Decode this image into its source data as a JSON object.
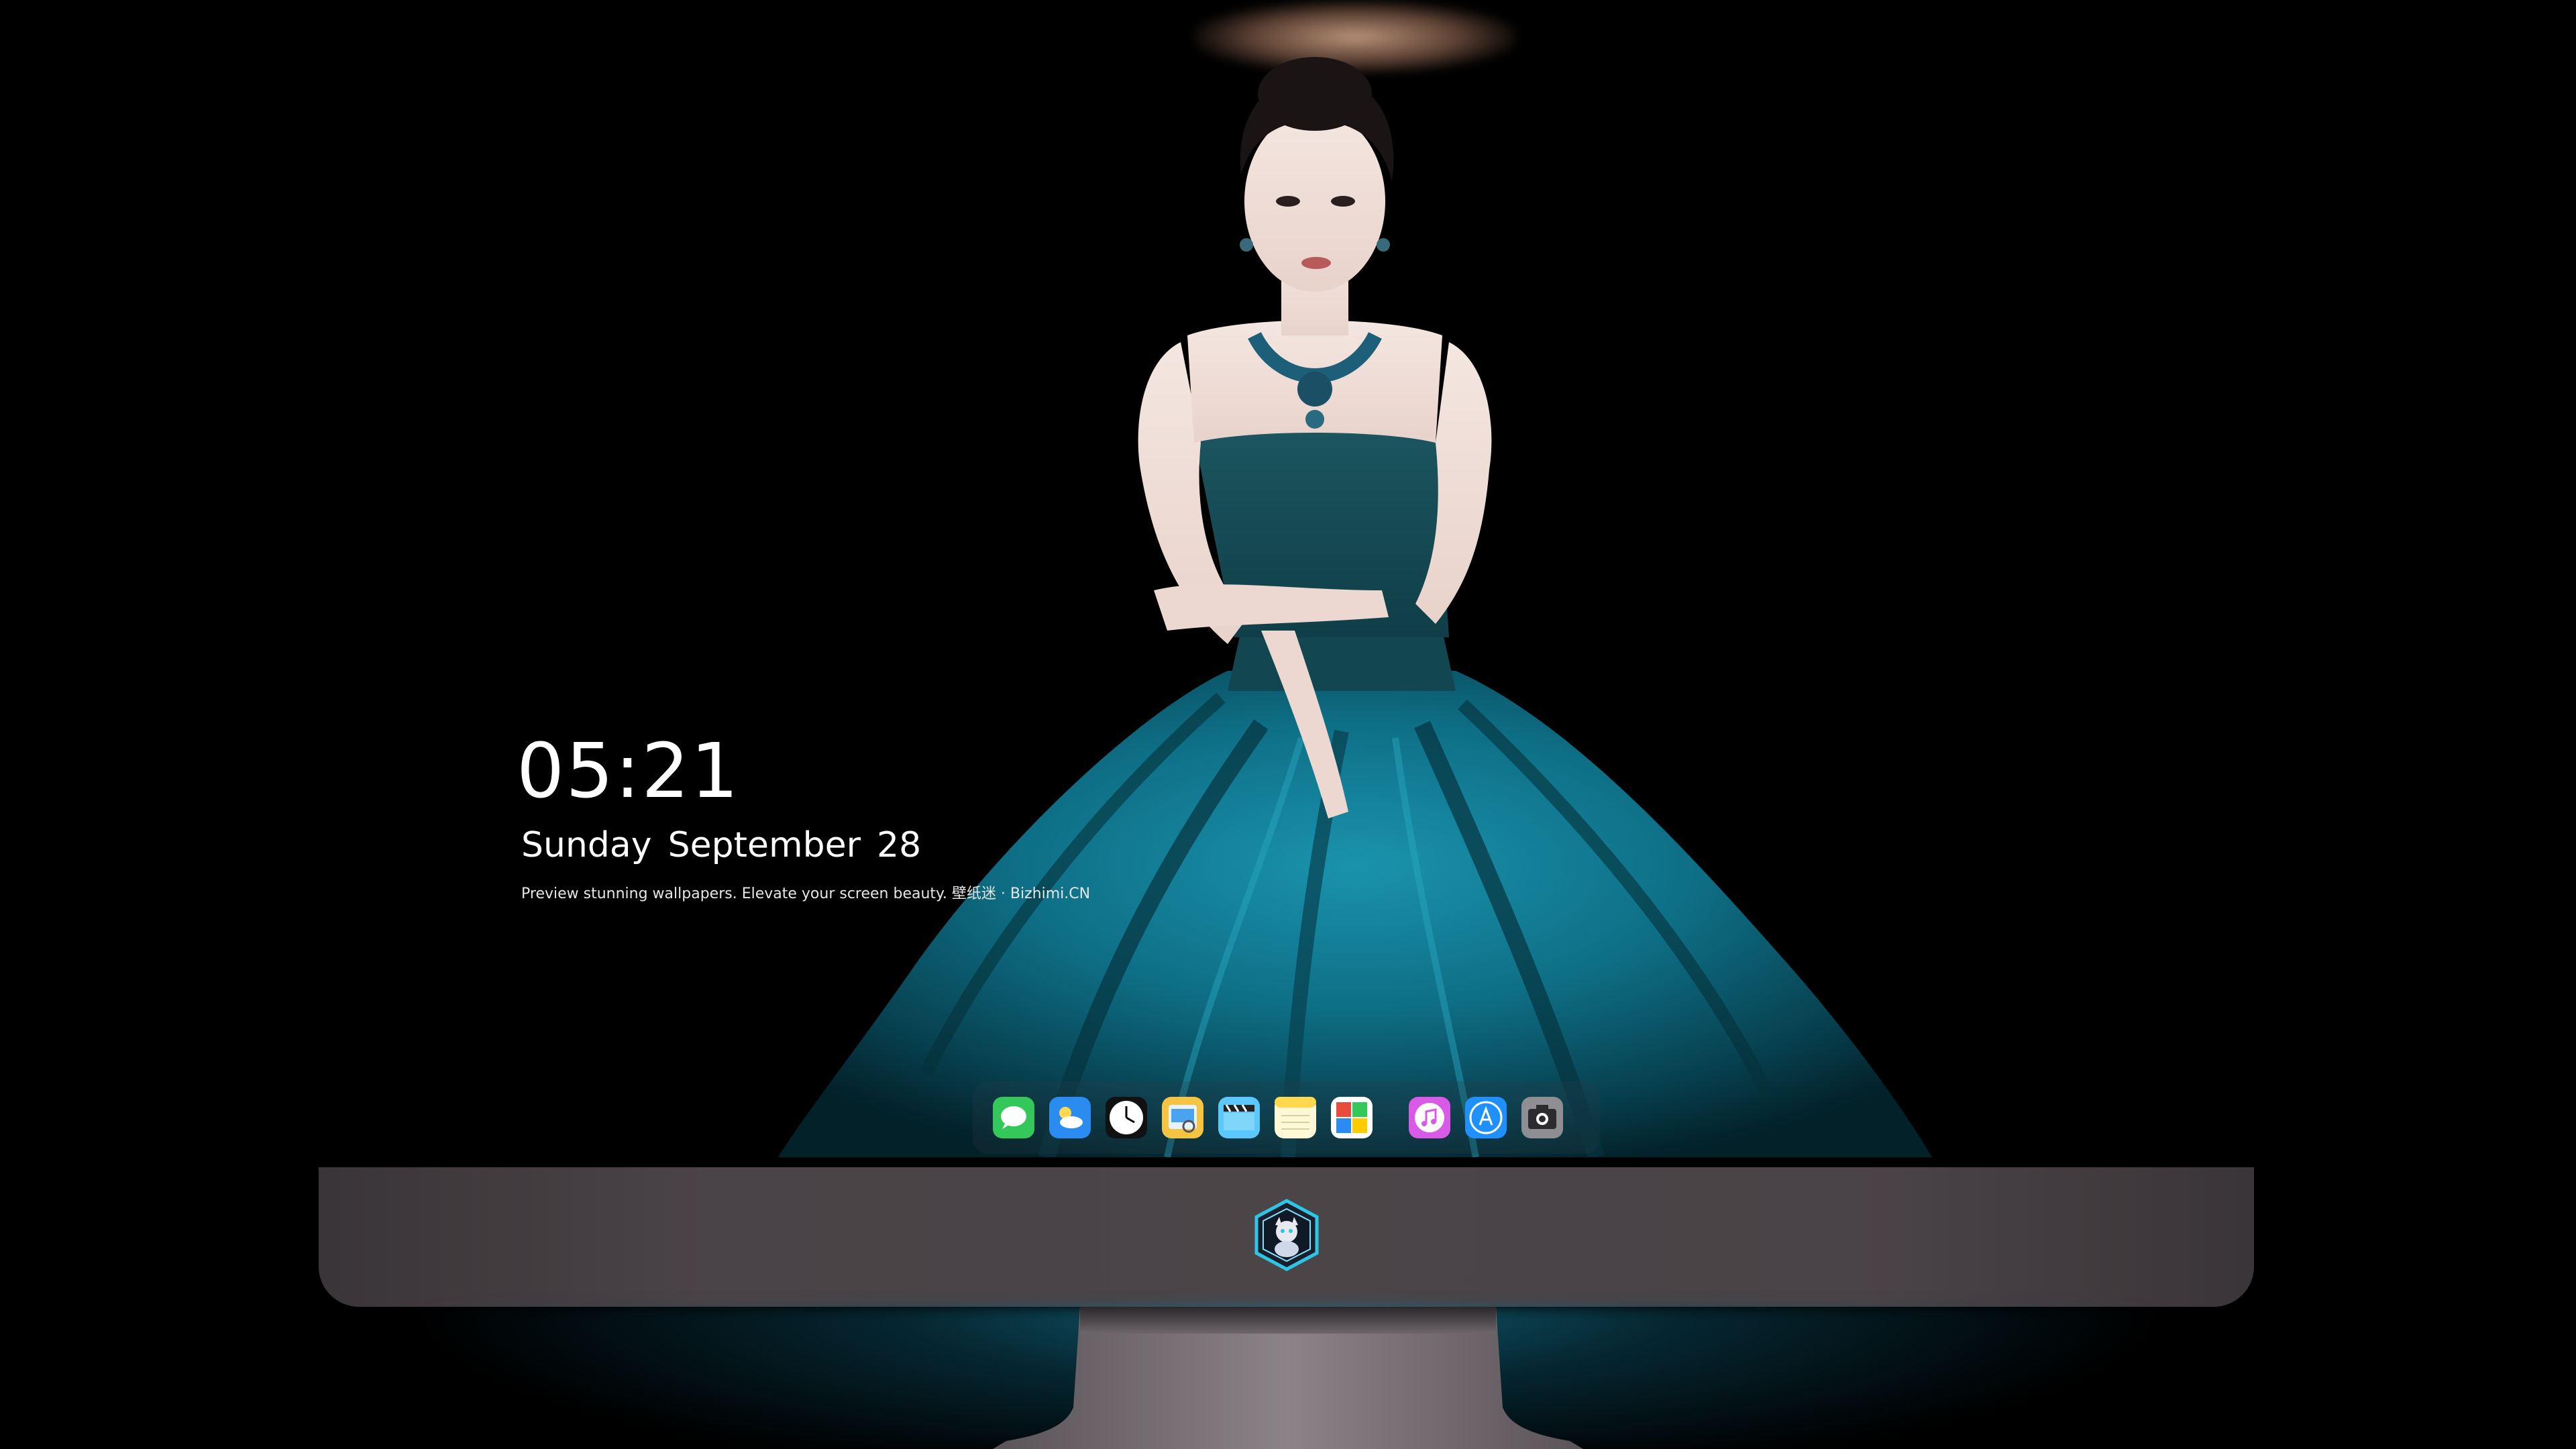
{
  "lockscreen": {
    "time": "05:21",
    "weekday": "Sunday",
    "month": "September",
    "day": "28",
    "tagline": "Preview stunning wallpapers. Elevate your screen beauty. 壁纸迷 · Bizhimi.CN"
  },
  "dock": {
    "apps": [
      {
        "name": "messages-icon",
        "color": "#34c759"
      },
      {
        "name": "weather-icon",
        "color": "#2a8cf0"
      },
      {
        "name": "clock-icon",
        "color": "#ffffff"
      },
      {
        "name": "preview-icon",
        "color": "#f5c542"
      },
      {
        "name": "clips-icon",
        "color": "#5ac8fa"
      },
      {
        "name": "notes-icon",
        "color": "#ffd84d"
      },
      {
        "name": "photo-booth-icon",
        "color": "#e94b3c"
      },
      {
        "name": "itunes-icon",
        "color": "#d85ae6"
      },
      {
        "name": "app-store-icon",
        "color": "#1e90ff"
      },
      {
        "name": "camera-icon",
        "color": "#8e8e93"
      }
    ]
  },
  "colors": {
    "background": "#000000",
    "gown": "#0e6f86",
    "chin": "#4a4347",
    "reflection": "#146e87"
  }
}
